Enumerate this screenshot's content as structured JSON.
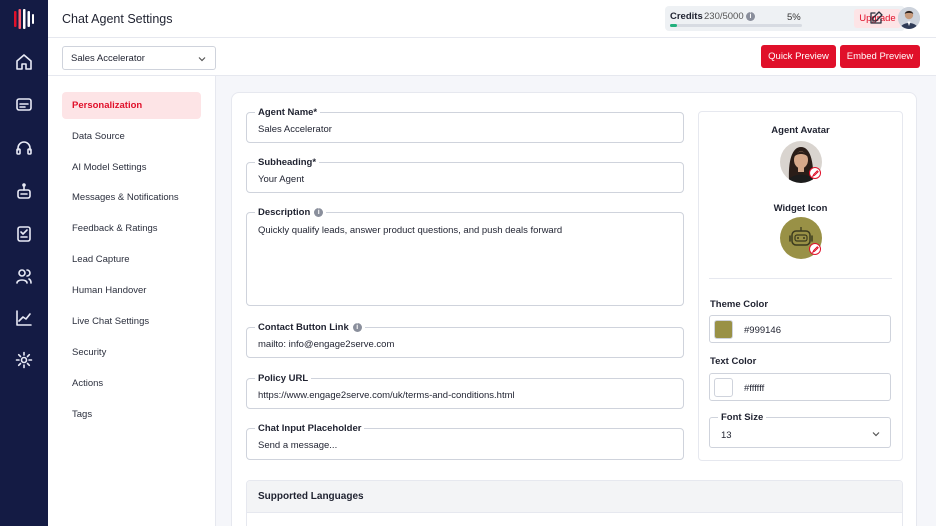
{
  "header": {
    "title": "Chat Agent Settings",
    "credits_label": "Credits",
    "credits_value": "230/5000",
    "credits_percent": "5%",
    "credits_fraction": 0.05,
    "upgrade_label": "Upgrade"
  },
  "agent_select": {
    "value": "Sales Accelerator"
  },
  "actions": {
    "quick_preview": "Quick Preview",
    "embed_preview": "Embed Preview"
  },
  "menu": {
    "items": [
      {
        "label": "Personalization",
        "active": true
      },
      {
        "label": "Data Source"
      },
      {
        "label": "AI Model Settings"
      },
      {
        "label": "Messages & Notifications"
      },
      {
        "label": "Feedback & Ratings"
      },
      {
        "label": "Lead Capture"
      },
      {
        "label": "Human Handover"
      },
      {
        "label": "Live Chat Settings"
      },
      {
        "label": "Security"
      },
      {
        "label": "Actions"
      },
      {
        "label": "Tags"
      }
    ]
  },
  "form": {
    "agent_name": {
      "label": "Agent Name*",
      "value": "Sales Accelerator"
    },
    "subheading": {
      "label": "Subheading*",
      "value": "Your Agent"
    },
    "description": {
      "label": "Description",
      "value": "Quickly qualify leads, answer product questions, and push deals forward"
    },
    "contact_link": {
      "label": "Contact Button Link",
      "value": "mailto: info@engage2serve.com"
    },
    "policy_url": {
      "label": "Policy URL",
      "value": "https://www.engage2serve.com/uk/terms-and-conditions.html"
    },
    "chat_placeholder": {
      "label": "Chat Input Placeholder",
      "value": "Send a message..."
    }
  },
  "appearance": {
    "agent_avatar_label": "Agent Avatar",
    "widget_icon_label": "Widget Icon",
    "theme_color_label": "Theme Color",
    "theme_color": "#999146",
    "text_color_label": "Text Color",
    "text_color": "#ffffff",
    "font_size_label": "Font Size",
    "font_size": "13"
  },
  "languages": {
    "title": "Supported Languages"
  },
  "colors": {
    "accent": "#e0102a",
    "rail": "#141b44",
    "theme": "#999146",
    "progress": "#22b07d"
  }
}
